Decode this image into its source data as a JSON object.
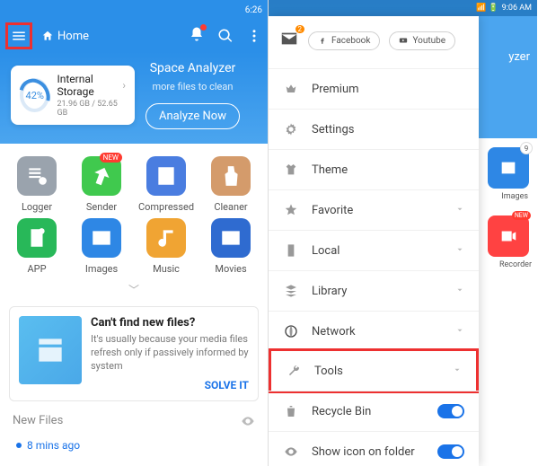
{
  "left": {
    "statusTime": "6:26",
    "home": "Home",
    "analyzer": {
      "pct": "42%",
      "storageName": "Internal Storage",
      "storageCap": "21.96 GB / 52.65 GB",
      "title": "Space Analyzer",
      "subtitle": "more files to clean",
      "btn": "Analyze Now"
    },
    "tiles": [
      {
        "label": "Logger",
        "bg": "#9aa3ad"
      },
      {
        "label": "Sender",
        "bg": "#40c94e",
        "badge": "NEW"
      },
      {
        "label": "Compressed",
        "bg": "#4a7de0"
      },
      {
        "label": "Cleaner",
        "bg": "#d49b6b"
      },
      {
        "label": "APP",
        "bg": "#28b859"
      },
      {
        "label": "Images",
        "bg": "#2e87e5"
      },
      {
        "label": "Music",
        "bg": "#f0a433"
      },
      {
        "label": "Movies",
        "bg": "#2f6bd0"
      }
    ],
    "card": {
      "title": "Can't find new files?",
      "body": "It's usually because your media files refresh only if passively informed by system",
      "cta": "SOLVE IT"
    },
    "newFiles": "New Files",
    "recent": "8 mins ago"
  },
  "right": {
    "statusTime": "9:06 AM",
    "mailCount": "2",
    "facebook": "Facebook",
    "youtube": "Youtube",
    "menu": [
      {
        "icon": "crown",
        "label": "Premium",
        "color": "#f5a623"
      },
      {
        "icon": "gear",
        "label": "Settings"
      },
      {
        "icon": "shirt",
        "label": "Theme"
      },
      {
        "icon": "star",
        "label": "Favorite",
        "chev": true
      },
      {
        "icon": "phone",
        "label": "Local",
        "chev": true
      },
      {
        "icon": "stack",
        "label": "Library",
        "chev": true
      },
      {
        "icon": "net",
        "label": "Network",
        "chev": true
      },
      {
        "icon": "wrench",
        "label": "Tools",
        "chev": true,
        "hl": true
      },
      {
        "icon": "trash",
        "label": "Recycle Bin",
        "toggle": true
      },
      {
        "icon": "eye",
        "label": "Show icon on folder",
        "toggle": true
      }
    ],
    "peek": {
      "analyzerLabel": "yzer",
      "images": {
        "label": "Images",
        "count": "9"
      },
      "recorder": {
        "label": "Recorder",
        "badge": "NEW"
      }
    }
  }
}
